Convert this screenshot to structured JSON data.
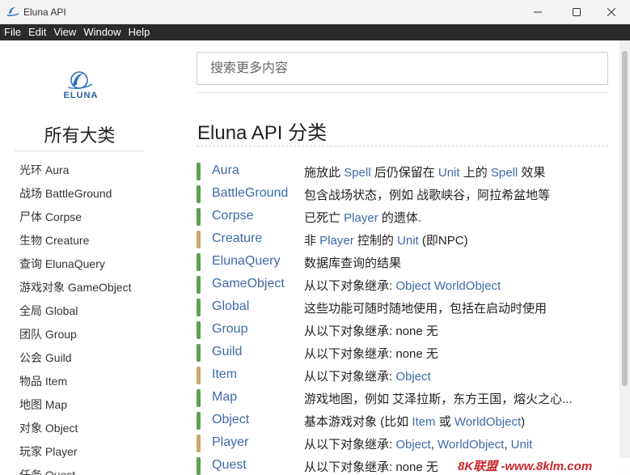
{
  "window": {
    "title": "Eluna API",
    "controls": [
      "minimize-icon",
      "maximize-icon",
      "close-icon"
    ]
  },
  "menubar": {
    "items": [
      "File",
      "Edit",
      "View",
      "Window",
      "Help"
    ]
  },
  "sidebar": {
    "logo_text": "ELUNA",
    "title": "所有大类",
    "items": [
      "光环 Aura",
      "战场 BattleGround",
      "尸体 Corpse",
      "生物 Creature",
      "查询 ElunaQuery",
      "游戏对象 GameObject",
      "全局 Global",
      "团队 Group",
      "公会 Guild",
      "物品 Item",
      "地图 Map",
      "对象 Object",
      "玩家 Player",
      "任务 Quest"
    ]
  },
  "search": {
    "placeholder": "搜索更多内容"
  },
  "main": {
    "heading": "Eluna API 分类",
    "colors": {
      "green": "#5aa24f",
      "tan": "#c9a86a",
      "link": "#3d6aa8"
    },
    "rows": [
      {
        "name": "Aura",
        "color": "green",
        "desc": [
          {
            "t": "施放此 "
          },
          {
            "t": "Spell",
            "link": true
          },
          {
            "t": " 后仍保留在 "
          },
          {
            "t": "Unit",
            "link": true
          },
          {
            "t": " 上的 "
          },
          {
            "t": "Spell",
            "link": true
          },
          {
            "t": " 效果"
          }
        ]
      },
      {
        "name": "BattleGround",
        "color": "green",
        "desc": [
          {
            "t": "包含战场状态，例如 战歌峡谷，阿拉希盆地等"
          }
        ]
      },
      {
        "name": "Corpse",
        "color": "green",
        "desc": [
          {
            "t": "已死亡 "
          },
          {
            "t": "Player",
            "link": true
          },
          {
            "t": " 的遗体."
          }
        ]
      },
      {
        "name": "Creature",
        "color": "tan",
        "desc": [
          {
            "t": "非 "
          },
          {
            "t": "Player",
            "link": true
          },
          {
            "t": " 控制的 "
          },
          {
            "t": "Unit",
            "link": true
          },
          {
            "t": " (即NPC)"
          }
        ]
      },
      {
        "name": "ElunaQuery",
        "color": "green",
        "desc": [
          {
            "t": "数据库查询的结果"
          }
        ]
      },
      {
        "name": "GameObject",
        "color": "green",
        "desc": [
          {
            "t": "从以下对象继承: "
          },
          {
            "t": "Object",
            "link": true
          },
          {
            "t": " "
          },
          {
            "t": "WorldObject",
            "link": true
          }
        ]
      },
      {
        "name": "Global",
        "color": "green",
        "desc": [
          {
            "t": "这些功能可随时随地使用，包括在启动时使用"
          }
        ]
      },
      {
        "name": "Group",
        "color": "green",
        "desc": [
          {
            "t": "从以下对象继承: none 无"
          }
        ]
      },
      {
        "name": "Guild",
        "color": "green",
        "desc": [
          {
            "t": "从以下对象继承: none 无"
          }
        ]
      },
      {
        "name": "Item",
        "color": "tan",
        "desc": [
          {
            "t": "从以下对象继承: "
          },
          {
            "t": "Object",
            "link": true
          }
        ]
      },
      {
        "name": "Map",
        "color": "green",
        "desc": [
          {
            "t": "游戏地图，例如 艾泽拉斯，东方王国，熔火之心..."
          }
        ]
      },
      {
        "name": "Object",
        "color": "green",
        "desc": [
          {
            "t": "基本游戏对象 (比如 "
          },
          {
            "t": "Item",
            "link": true
          },
          {
            "t": " 或 "
          },
          {
            "t": "WorldObject",
            "link": true
          },
          {
            "t": ")"
          }
        ]
      },
      {
        "name": "Player",
        "color": "tan",
        "desc": [
          {
            "t": "从以下对象继承: "
          },
          {
            "t": "Object",
            "link": true
          },
          {
            "t": ", "
          },
          {
            "t": "WorldObject",
            "link": true
          },
          {
            "t": ", "
          },
          {
            "t": "Unit",
            "link": true
          }
        ]
      },
      {
        "name": "Quest",
        "color": "green",
        "desc": [
          {
            "t": "从以下对象继承: none 无"
          }
        ]
      }
    ]
  },
  "watermark": "8K联盟 -www.8klm.com"
}
